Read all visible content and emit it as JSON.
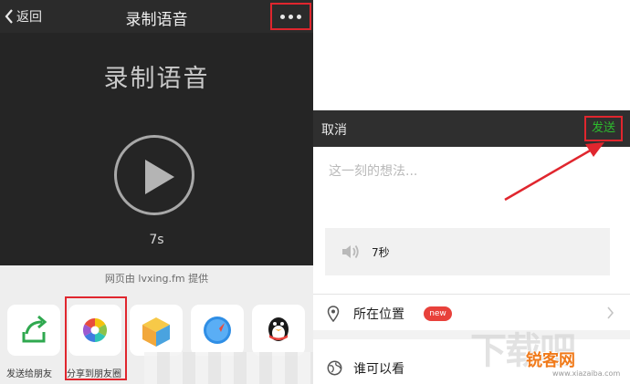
{
  "left": {
    "nav": {
      "back_label": "返回",
      "title": "录制语音"
    },
    "player": {
      "title": "录制语音",
      "duration": "7s"
    },
    "share_sheet": {
      "provider_text": "网页由 lvxing.fm 提供",
      "items": [
        {
          "label": "发送给朋友",
          "icon": "share-forward-icon"
        },
        {
          "label": "分享到朋友圈",
          "icon": "moments-aperture-icon"
        },
        {
          "label": "",
          "icon": "favorite-cube-icon"
        },
        {
          "label": "",
          "icon": "safari-compass-icon"
        },
        {
          "label": "",
          "icon": "qq-penguin-icon"
        }
      ]
    }
  },
  "right": {
    "compose_bar": {
      "cancel_label": "取消",
      "send_label": "发送"
    },
    "compose_placeholder": "这一刻的想法...",
    "voice_attachment": {
      "icon": "speaker-icon",
      "length": "7秒"
    },
    "location_row": {
      "label": "所在位置",
      "badge": "new",
      "icon": "location-pin-icon"
    },
    "visibility_row": {
      "label": "谁可以看",
      "icon": "globe-icon"
    }
  },
  "watermark": {
    "big_text": "下载吧",
    "brand": "锐客网",
    "url": "www.xiazaiba.com"
  },
  "colors": {
    "highlight": "#e0262e",
    "send_green": "#2dbb2d",
    "new_badge": "#e8413b",
    "brand_orange": "#f07a1a"
  }
}
